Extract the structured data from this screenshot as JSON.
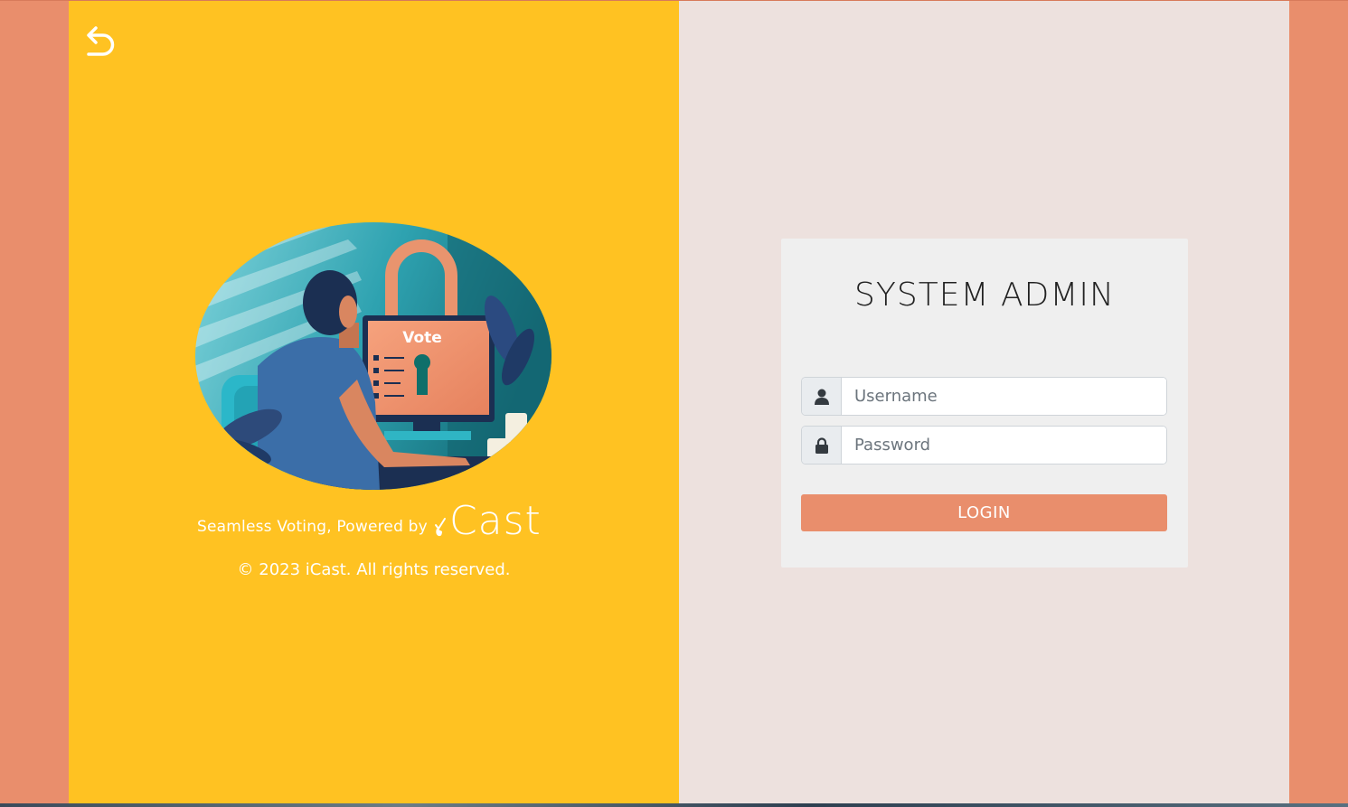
{
  "colors": {
    "outer_background": "#e98e6c",
    "left_panel": "#ffc222",
    "right_panel": "#ede1de",
    "card": "#efefef",
    "accent": "#e98e6c"
  },
  "left_panel": {
    "back_icon": "undo-arrow-icon",
    "illustration": "person-voting-at-computer-illustration",
    "monitor_text": "Vote",
    "tagline": "Seamless Voting, Powered by",
    "brand_name": "Cast",
    "brand_icon": "ballot-check-icon",
    "copyright": "© 2023 iCast. All rights reserved."
  },
  "login": {
    "title": "SYSTEM ADMIN",
    "username": {
      "icon": "user-icon",
      "placeholder": "Username",
      "value": ""
    },
    "password": {
      "icon": "lock-icon",
      "placeholder": "Password",
      "value": ""
    },
    "button_label": "LOGIN"
  }
}
